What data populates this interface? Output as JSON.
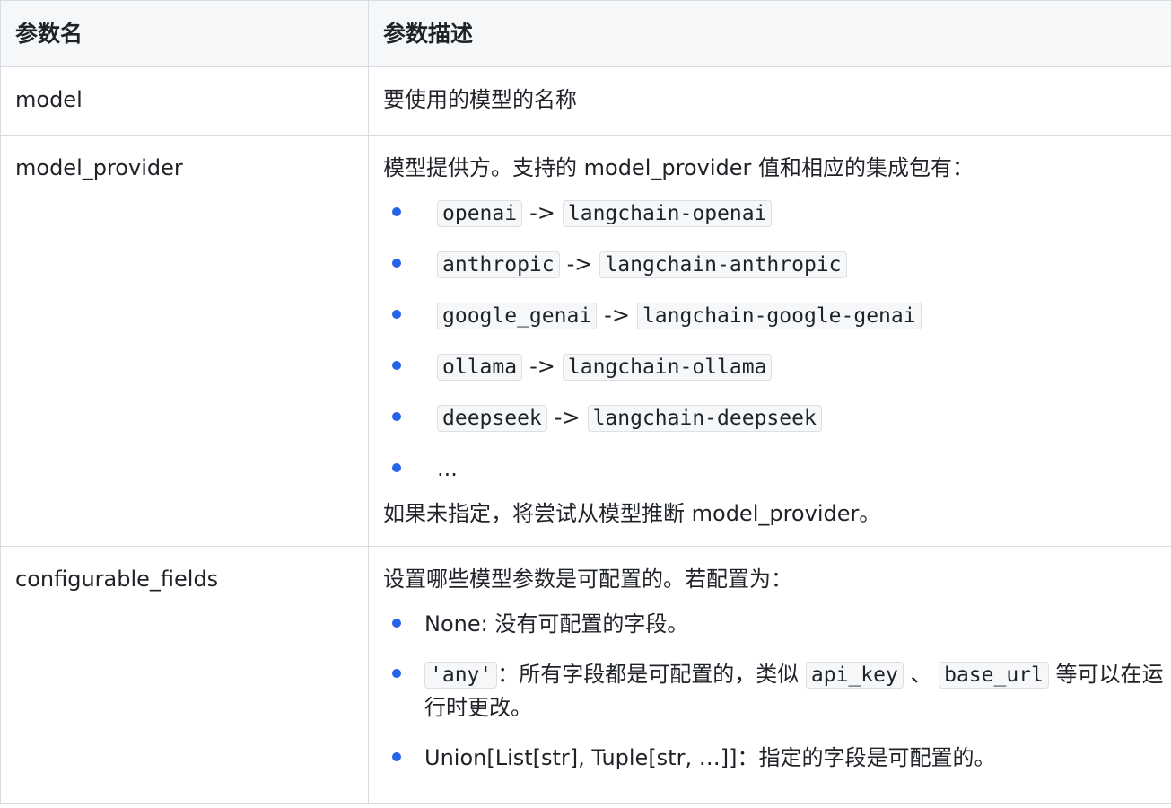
{
  "header": {
    "col1": "参数名",
    "col2": "参数描述"
  },
  "rows": {
    "model": {
      "name": "model",
      "desc": "要使用的模型的名称"
    },
    "model_provider": {
      "name": "model_provider",
      "intro": "模型提供方。支持的 model_provider 值和相应的集成包有：",
      "items": [
        {
          "key": "openai",
          "arrow": "->",
          "pkg": "langchain-openai"
        },
        {
          "key": "anthropic",
          "arrow": "->",
          "pkg": "langchain-anthropic"
        },
        {
          "key": "google_genai",
          "arrow": "->",
          "pkg": "langchain-google-genai"
        },
        {
          "key": "ollama",
          "arrow": "->",
          "pkg": "langchain-ollama"
        },
        {
          "key": "deepseek",
          "arrow": "->",
          "pkg": "langchain-deepseek"
        }
      ],
      "ellipsis": "...",
      "outro": "如果未指定，将尝试从模型推断 model_provider。"
    },
    "configurable_fields": {
      "name": "configurable_fields",
      "intro": "设置哪些模型参数是可配置的。若配置为：",
      "item_none": "None: 没有可配置的字段。",
      "item_any": {
        "code": "'any'",
        "text1": "：所有字段都是可配置的，类似",
        "code2": "api_key",
        "sep": "、",
        "code3": "base_url",
        "text2": "等可以在运行时更改。"
      },
      "item_union": "Union[List[str], Tuple[str, …]]：指定的字段是可配置的。"
    }
  },
  "colors": {
    "bullet": "#2563eb",
    "header_bg": "#f6f7f9",
    "border": "#d9dde3"
  }
}
